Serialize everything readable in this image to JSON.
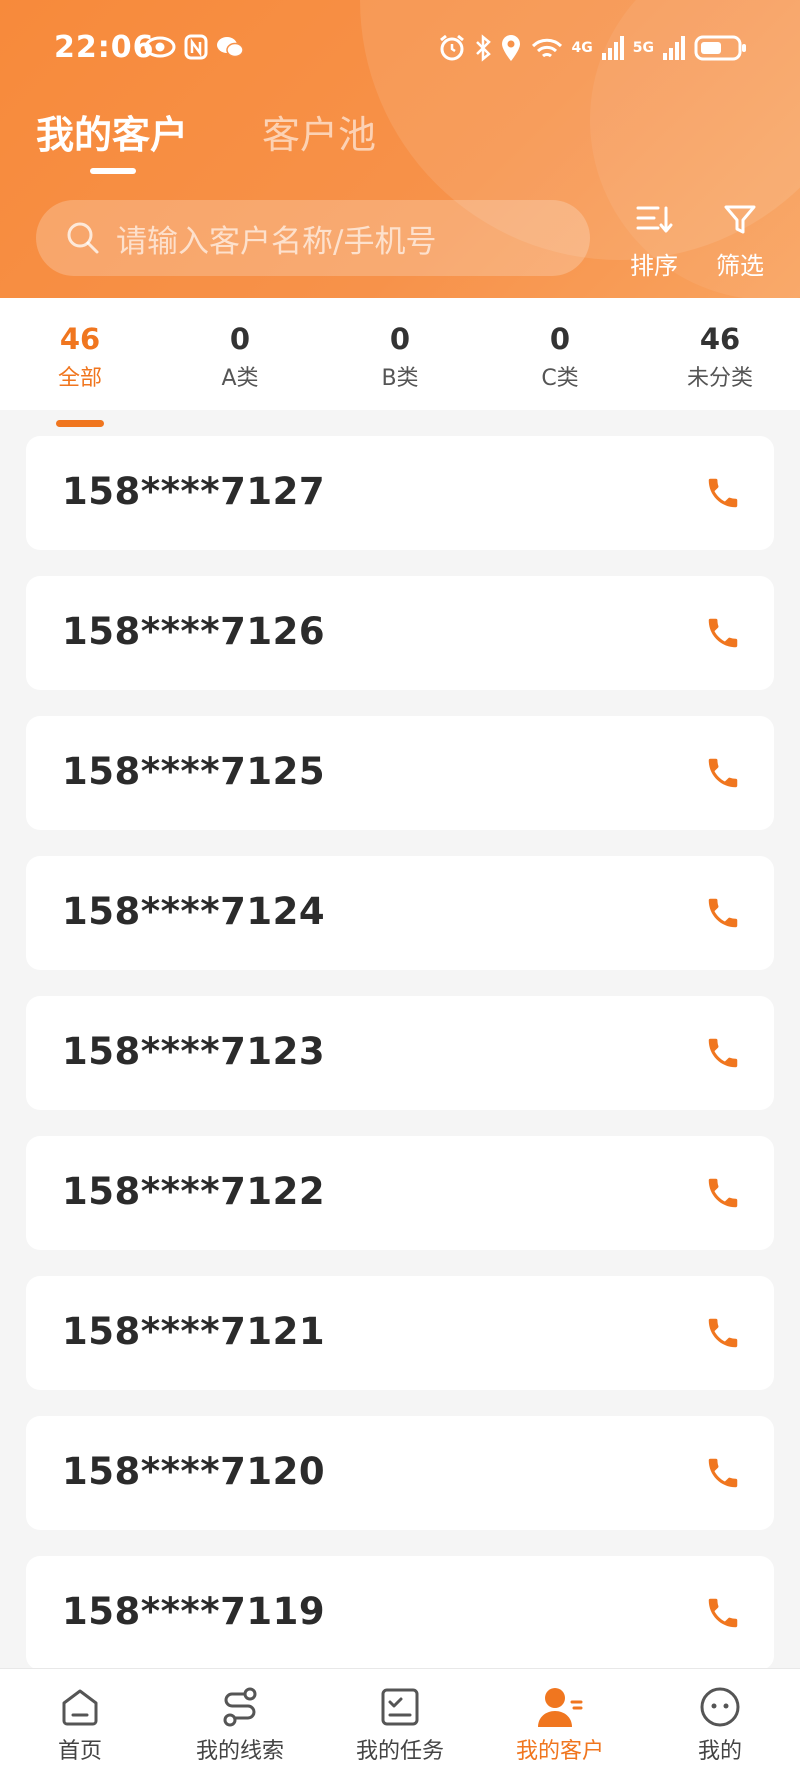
{
  "status_bar": {
    "time": "22:06",
    "network_4g": "4G",
    "network_5g": "5G"
  },
  "tabs": [
    {
      "label": "我的客户",
      "active": true
    },
    {
      "label": "客户池",
      "active": false
    }
  ],
  "search": {
    "placeholder": "请输入客户名称/手机号"
  },
  "toolbar": {
    "sort_label": "排序",
    "filter_label": "筛选"
  },
  "stats": [
    {
      "count": "46",
      "label": "全部",
      "active": true
    },
    {
      "count": "0",
      "label": "A类",
      "active": false
    },
    {
      "count": "0",
      "label": "B类",
      "active": false
    },
    {
      "count": "0",
      "label": "C类",
      "active": false
    },
    {
      "count": "46",
      "label": "未分类",
      "active": false
    }
  ],
  "customers": [
    {
      "phone": "158****7127"
    },
    {
      "phone": "158****7126"
    },
    {
      "phone": "158****7125"
    },
    {
      "phone": "158****7124"
    },
    {
      "phone": "158****7123"
    },
    {
      "phone": "158****7122"
    },
    {
      "phone": "158****7121"
    },
    {
      "phone": "158****7120"
    },
    {
      "phone": "158****7119"
    }
  ],
  "bottom_nav": [
    {
      "label": "首页",
      "icon": "home-icon",
      "active": false
    },
    {
      "label": "我的线索",
      "icon": "leads-icon",
      "active": false
    },
    {
      "label": "我的任务",
      "icon": "tasks-icon",
      "active": false
    },
    {
      "label": "我的客户",
      "icon": "customers-icon",
      "active": true
    },
    {
      "label": "我的",
      "icon": "profile-icon",
      "active": false
    }
  ],
  "colors": {
    "accent": "#f0761f",
    "header_start": "#f78a3b",
    "header_end": "#f9a35f",
    "background": "#f5f5f5"
  }
}
